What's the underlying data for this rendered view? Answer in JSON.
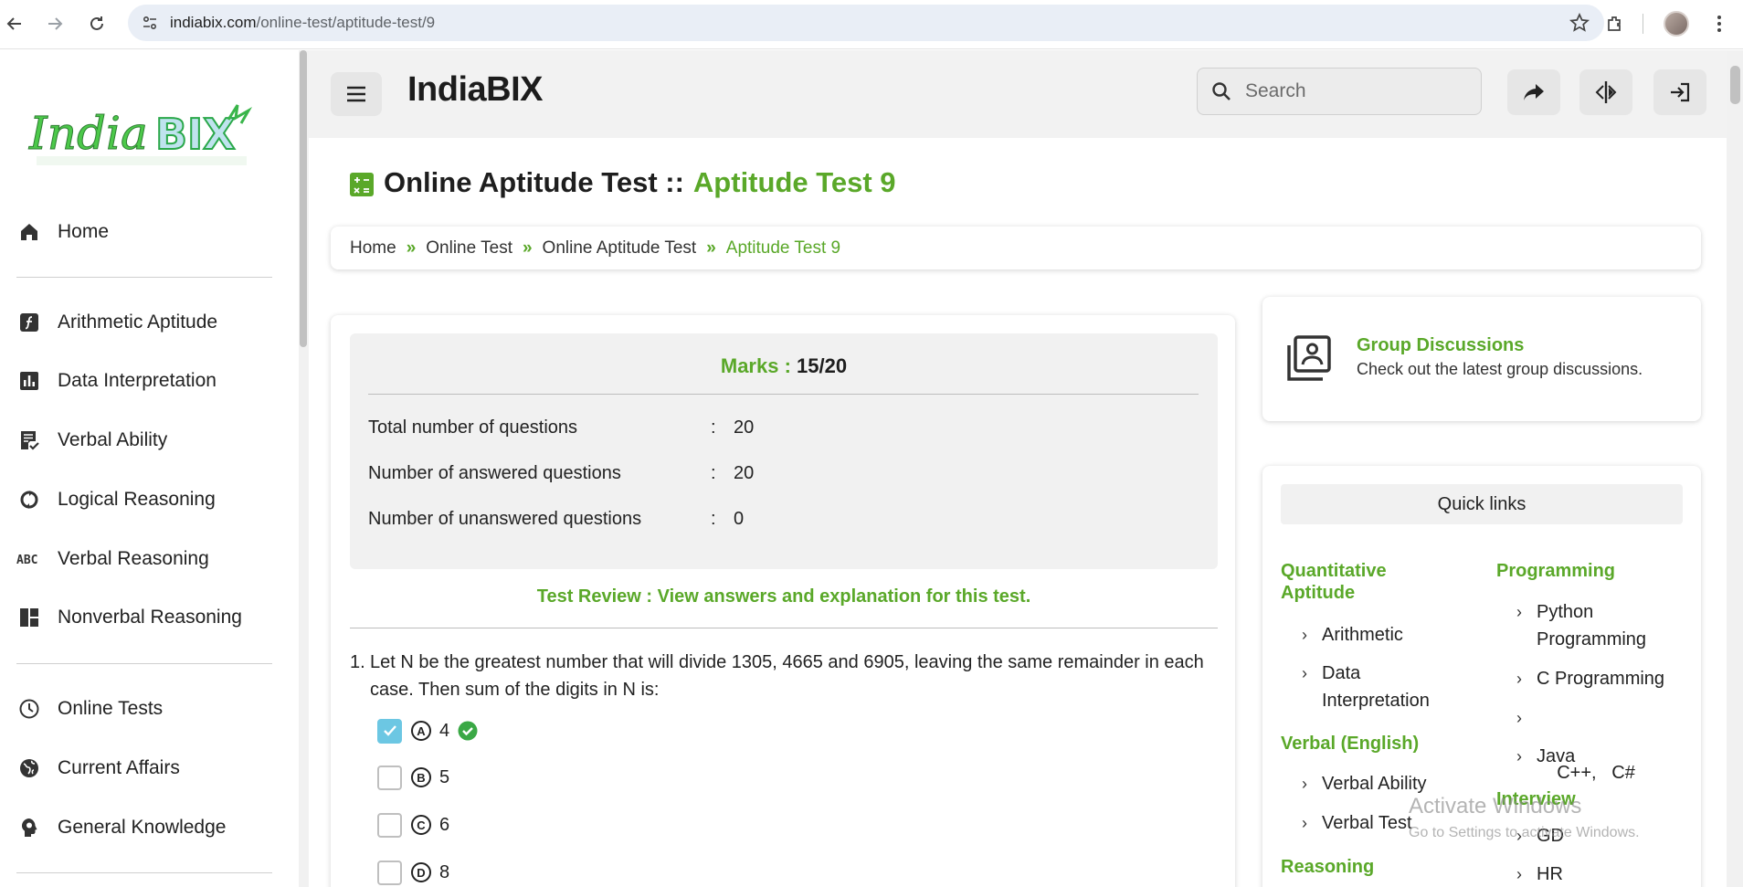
{
  "browser": {
    "url_domain": "indiabix.com",
    "url_path": "/online-test/aptitude-test/9"
  },
  "logo_text": "IndiaBIX",
  "sidebar": {
    "items": [
      {
        "label": "Home",
        "icon": "home-icon"
      },
      {
        "label": "Arithmetic Aptitude",
        "icon": "function-icon"
      },
      {
        "label": "Data Interpretation",
        "icon": "bar-chart-icon"
      },
      {
        "label": "Verbal Ability",
        "icon": "document-check-icon"
      },
      {
        "label": "Logical Reasoning",
        "icon": "cycle-icon"
      },
      {
        "label": "Verbal Reasoning",
        "icon": "abc-icon"
      },
      {
        "label": "Nonverbal Reasoning",
        "icon": "dashboard-icon"
      },
      {
        "label": "Online Tests",
        "icon": "clock-icon"
      },
      {
        "label": "Current Affairs",
        "icon": "globe-icon"
      },
      {
        "label": "General Knowledge",
        "icon": "head-bulb-icon"
      }
    ]
  },
  "header": {
    "brand": "IndiaBIX",
    "search_placeholder": "Search"
  },
  "page": {
    "title_prefix": "Online Aptitude Test ::",
    "title_accent": "Aptitude Test 9"
  },
  "breadcrumb": {
    "items": [
      "Home",
      "Online Test",
      "Online Aptitude Test"
    ],
    "current": "Aptitude Test 9",
    "separator": "»"
  },
  "results": {
    "marks_label": "Marks :",
    "marks_value": "15/20",
    "rows": [
      {
        "label": "Total number of questions",
        "value": "20"
      },
      {
        "label": "Number of answered questions",
        "value": "20"
      },
      {
        "label": "Number of unanswered questions",
        "value": "0"
      }
    ],
    "colon": ":",
    "review_link": "Test Review : View answers and explanation for this test."
  },
  "question": {
    "number": "1.",
    "text": "Let N be the greatest number that will divide 1305, 4665 and 6905, leaving the same remainder in each case. Then sum of the digits in N is:",
    "options": [
      {
        "letter": "A",
        "value": "4",
        "checked": true,
        "correct": true
      },
      {
        "letter": "B",
        "value": "5",
        "checked": false,
        "correct": false
      },
      {
        "letter": "C",
        "value": "6",
        "checked": false,
        "correct": false
      },
      {
        "letter": "D",
        "value": "8",
        "checked": false,
        "correct": false
      }
    ]
  },
  "group_discussions": {
    "title": "Group Discussions",
    "subtitle": "Check out the latest group discussions."
  },
  "quick_links": {
    "heading": "Quick links",
    "left": [
      {
        "section": "Quantitative Aptitude",
        "links": [
          "Arithmetic",
          "Data Interpretation"
        ]
      },
      {
        "section": "Verbal (English)",
        "links": [
          "Verbal Ability",
          "Verbal Test"
        ]
      },
      {
        "section": "Reasoning",
        "links": []
      }
    ],
    "right": [
      {
        "section": "Programming",
        "links": [
          "Python Programming",
          "C Programming",
          "C++,   C#",
          "Java"
        ]
      },
      {
        "section": "Interview",
        "links": [
          "GD",
          "HR"
        ]
      }
    ]
  },
  "watermark": {
    "line1": "Activate Windows",
    "line2": "Go to Settings to activate Windows."
  },
  "colors": {
    "accent": "#5aa829",
    "checkbox_checked": "#6cc7e3",
    "panel_bg": "#f1f1f1"
  }
}
